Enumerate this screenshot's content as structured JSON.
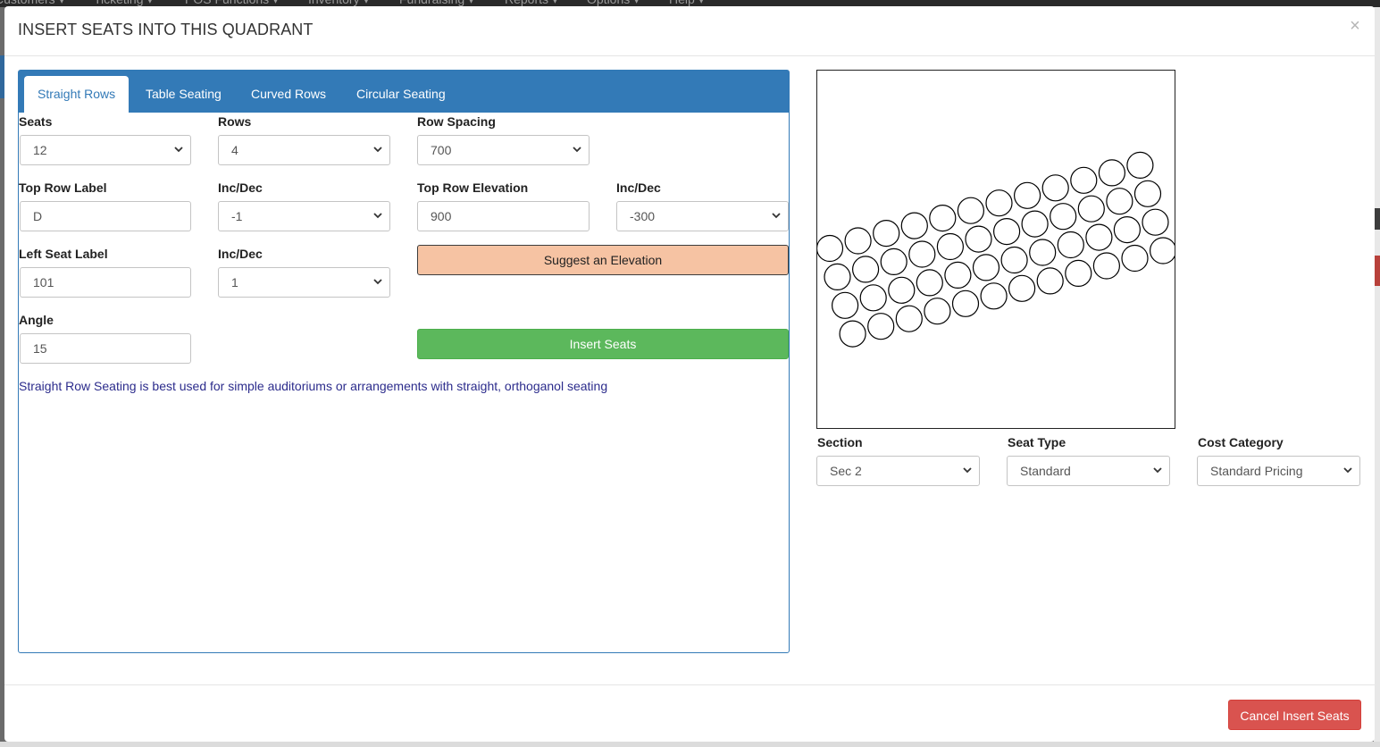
{
  "background": {
    "navbar_items": [
      "Customers ▾",
      "Ticketing ▾",
      "POS Functions ▾",
      "Inventory ▾",
      "Fundraising ▾",
      "Reports ▾",
      "Options ▾",
      "Help ▾"
    ]
  },
  "modal": {
    "title": "INSERT SEATS INTO THIS QUADRANT",
    "close_label": "×"
  },
  "tabs": [
    {
      "label": "Straight Rows",
      "active": true
    },
    {
      "label": "Table Seating",
      "active": false
    },
    {
      "label": "Curved Rows",
      "active": false
    },
    {
      "label": "Circular Seating",
      "active": false
    }
  ],
  "form": {
    "seats": {
      "label": "Seats",
      "value": "12"
    },
    "rows": {
      "label": "Rows",
      "value": "4"
    },
    "row_spacing": {
      "label": "Row Spacing",
      "value": "700"
    },
    "top_row_label": {
      "label": "Top Row Label",
      "value": "D"
    },
    "row_label_incdec": {
      "label": "Inc/Dec",
      "value": "-1"
    },
    "top_row_elevation": {
      "label": "Top Row Elevation",
      "value": "900"
    },
    "elevation_incdec": {
      "label": "Inc/Dec",
      "value": "-300"
    },
    "left_seat_label": {
      "label": "Left Seat Label",
      "value": "101"
    },
    "seat_label_incdec": {
      "label": "Inc/Dec",
      "value": "1"
    },
    "angle": {
      "label": "Angle",
      "value": "15"
    },
    "suggest_button": "Suggest an Elevation",
    "insert_button": "Insert Seats",
    "help_text": "Straight Row Seating is best used for simple auditoriums or arrangements with straight, orthoganol seating"
  },
  "preview": {
    "seats_per_row": 12,
    "rows": 4,
    "angle_degrees": 15
  },
  "assignment": {
    "section": {
      "label": "Section",
      "value": "Sec 2"
    },
    "seat_type": {
      "label": "Seat Type",
      "value": "Standard"
    },
    "cost_category": {
      "label": "Cost Category",
      "value": "Standard Pricing"
    }
  },
  "footer": {
    "cancel_button": "Cancel Insert Seats"
  },
  "colors": {
    "primary": "#337ab7",
    "success": "#5cb85c",
    "danger": "#d9534f",
    "warning_light": "#f6c3a3"
  }
}
